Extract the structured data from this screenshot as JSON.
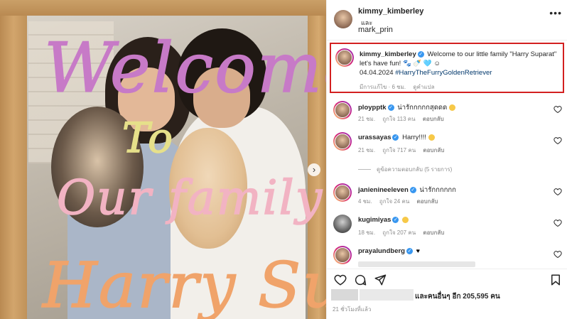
{
  "photo": {
    "scribbles": [
      "Welcome",
      "To",
      "Our family",
      "Harry Suparat"
    ],
    "next_icon": "chevron-right-icon"
  },
  "header": {
    "username": "kimmy_kimberley",
    "and_text": "และ",
    "collaborator": "mark_prin",
    "more_icon": "more-horizontal-icon"
  },
  "caption": {
    "username": "kimmy_kimberley",
    "text": "Welcome to our little family \"Harry Suparat\" let's have fun! 🐾 🍼 🩵 ☺",
    "date_tag_prefix": "04.04.2024 ",
    "hashtag": "#HarryTheFurryGoldenRetriever",
    "edited": "มีการแก้ไข · 6 ชม.",
    "see_translation": "ดูคำแปล",
    "border_color": "#d32020"
  },
  "comments": [
    {
      "username": "ploypptk",
      "verified": true,
      "text": "น่ารักกกกกสุดดด",
      "emoji": "heart-eyes",
      "time": "21 ชม.",
      "likes": "ถูกใจ 113 คน",
      "reply": "ตอบกลับ",
      "ring": true
    },
    {
      "username": "urassayas",
      "verified": true,
      "text": "Harry!!!!",
      "emoji": "heart-eyes",
      "time": "21 ชม.",
      "likes": "ถูกใจ 717 คน",
      "reply": "ตอบกลับ",
      "ring": true
    },
    {
      "username": "janienineeleven",
      "verified": true,
      "text": "น่ารักกกกกก",
      "emoji": "",
      "time": "4 ชม.",
      "likes": "ถูกใจ 24 คน",
      "reply": "ตอบกลับ",
      "ring": true
    },
    {
      "username": "kugimiyas",
      "verified": true,
      "text": "",
      "emoji": "heart-eyes",
      "time": "18 ชม.",
      "likes": "ถูกใจ 207 คน",
      "reply": "ตอบกลับ",
      "ring": false
    },
    {
      "username": "prayalundberg",
      "verified": true,
      "text": "",
      "emoji": "black-heart",
      "time": "",
      "likes": "",
      "reply": "",
      "ring": true
    }
  ],
  "view_replies": "ดูข้อความตอบกลับ (5 รายการ)",
  "actions": {
    "like_icon": "heart-icon",
    "comment_icon": "comment-icon",
    "share_icon": "send-icon",
    "save_icon": "bookmark-icon"
  },
  "likes_text": "และคนอื่นๆ อีก 205,595 คน",
  "time_ago": "21 ชั่วโมงที่แล้ว",
  "colors": {
    "link": "#00376b",
    "muted": "#8e8e8e",
    "verified": "#3897f0"
  }
}
